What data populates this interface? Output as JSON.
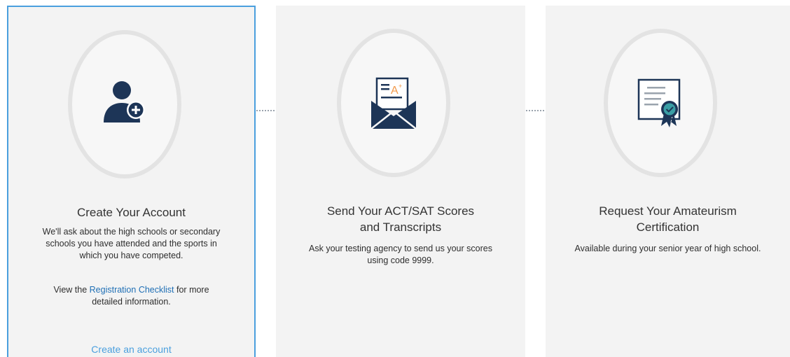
{
  "steps": [
    {
      "title_line1": "Create Your Account",
      "title_line2": "",
      "description": "We'll ask about the high schools or secondary schools you have attended and the sports in which you have competed.",
      "extra_prefix": "View the ",
      "extra_link": "Registration Checklist",
      "extra_suffix": " for more detailed information.",
      "cta": "Create an account",
      "icon": "user-add-icon"
    },
    {
      "title_line1": "Send Your ACT/SAT Scores",
      "title_line2": "and Transcripts",
      "description": "Ask your testing agency to send us your scores using code 9999.",
      "icon": "envelope-scores-icon"
    },
    {
      "title_line1": "Request Your Amateurism",
      "title_line2": "Certification",
      "description": "Available during your senior year of high school.",
      "icon": "certificate-icon"
    }
  ],
  "colors": {
    "accent": "#4a9fde",
    "link": "#1f6fb5",
    "icon": "#1d3557",
    "icon_accent": "#f2994a",
    "icon_badge": "#3a9ea5",
    "card_bg": "#f3f3f3"
  }
}
